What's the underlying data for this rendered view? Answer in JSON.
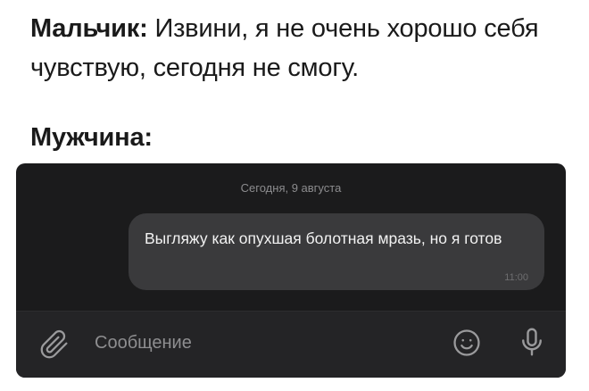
{
  "captions": {
    "boy": {
      "speaker": "Мальчик:",
      "text": "Извини, я не очень хорошо себя чувствую, сегодня не смогу."
    },
    "man": {
      "speaker": "Мужчина:"
    }
  },
  "chat": {
    "date_label": "Сегодня, 9 августа",
    "message": {
      "text": "Выгляжу как опухшая болотная мразь, но я готов",
      "time": "11:00"
    },
    "input": {
      "placeholder": "Сообщение"
    },
    "icons": {
      "attach": "paperclip-icon",
      "emoji": "emoji-icon",
      "mic": "microphone-icon"
    },
    "colors": {
      "background": "#1b1b1c",
      "bubble": "#3a3a3c",
      "input_bar": "#242426",
      "muted_text": "#8e8e90"
    }
  }
}
